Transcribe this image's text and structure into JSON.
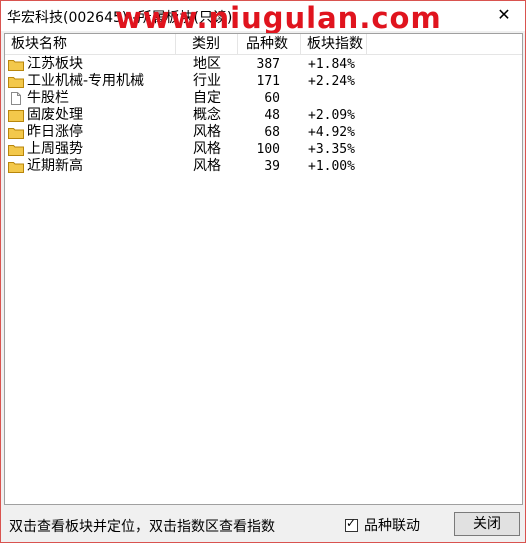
{
  "window": {
    "title": "华宏科技(002645)--所属板块(只读)",
    "close_glyph": "✕",
    "watermark": "www.niugulan.com"
  },
  "columns": {
    "name": "板块名称",
    "type": "类别",
    "count": "品种数",
    "index": "板块指数"
  },
  "rows": [
    {
      "name": "江苏板块",
      "type": "地区",
      "count": "387",
      "index": "+1.84%",
      "icon": "folder-icon"
    },
    {
      "name": "工业机械-专用机械",
      "type": "行业",
      "count": "171",
      "index": "+2.24%",
      "icon": "folder-icon"
    },
    {
      "name": "牛股栏",
      "type": "自定",
      "count": "60",
      "index": "",
      "icon": "document-icon"
    },
    {
      "name": "固废处理",
      "type": "概念",
      "count": "48",
      "index": "+2.09%",
      "icon": "folder-icon"
    },
    {
      "name": "昨日涨停",
      "type": "风格",
      "count": "68",
      "index": "+4.92%",
      "icon": "folder-icon"
    },
    {
      "name": "上周强势",
      "type": "风格",
      "count": "100",
      "index": "+3.35%",
      "icon": "folder-icon"
    },
    {
      "name": "近期新高",
      "type": "风格",
      "count": "39",
      "index": "+1.00%",
      "icon": "folder-icon"
    }
  ],
  "footer": {
    "hint": "双击查看板块并定位，双击指数区查看指数",
    "link_checkbox_label": "品种联动",
    "link_checkbox_checked": true,
    "close_button": "关闭"
  },
  "colors": {
    "window_border": "#d9534f",
    "watermark": "#e0141e",
    "folder_fill": "#f3c84b",
    "folder_stroke": "#b8860b"
  }
}
